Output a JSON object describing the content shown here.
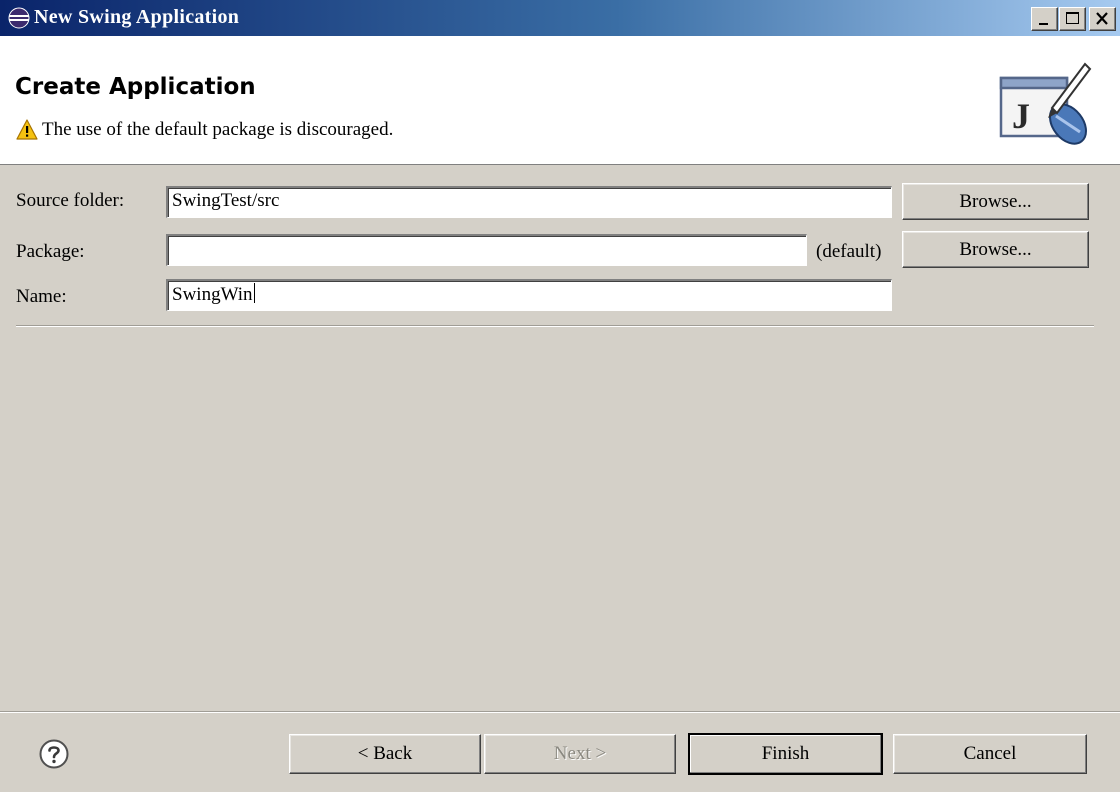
{
  "window": {
    "title": "New Swing Application",
    "colors": {
      "titlebar_start": "#0a246a",
      "titlebar_end": "#a6caf0",
      "face": "#d4d0c8"
    }
  },
  "header": {
    "title": "Create Application",
    "message": "The use of the default package is discouraged.",
    "message_icon": "warning-icon",
    "wizard_icon": "java-class-wizard-icon",
    "wizard_glyph": "J"
  },
  "form": {
    "source_folder": {
      "label": "Source folder:",
      "value": "SwingTest/src",
      "browse_label": "Browse..."
    },
    "package": {
      "label": "Package:",
      "value": "",
      "suffix": "(default)",
      "browse_label": "Browse..."
    },
    "name": {
      "label": "Name:",
      "value": "SwingWin"
    }
  },
  "footer": {
    "help_icon": "help-icon",
    "back_label": "< Back",
    "next_label": "Next >",
    "finish_label": "Finish",
    "cancel_label": "Cancel"
  }
}
